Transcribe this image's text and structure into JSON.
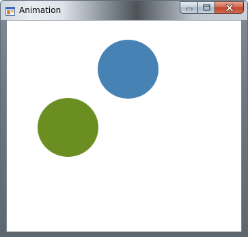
{
  "window": {
    "title": "Animation"
  },
  "caption_buttons": {
    "minimize": "minimize",
    "maximize": "maximize",
    "close": "close"
  },
  "canvas": {
    "balls": [
      {
        "name": "blue",
        "color": "#4682b4"
      },
      {
        "name": "green",
        "color": "#6b8e23"
      }
    ]
  }
}
